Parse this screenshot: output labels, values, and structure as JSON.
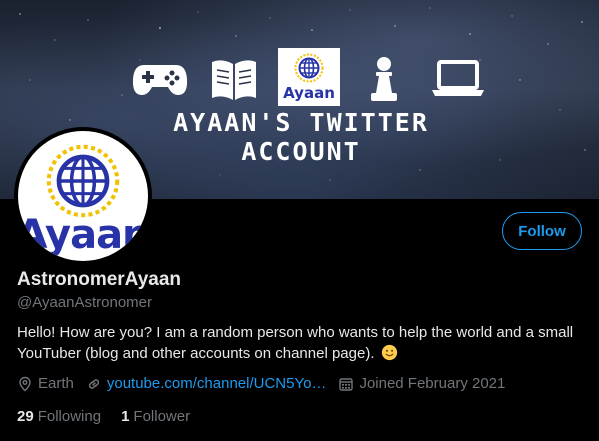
{
  "banner": {
    "title": "AYAAN'S TWITTER ACCOUNT",
    "logo_text": "Ayaan",
    "icons": [
      "gamepad-icon",
      "book-icon",
      "ayaan-logo",
      "chess-pawn-icon",
      "laptop-icon"
    ]
  },
  "avatar": {
    "text": "Ayaan"
  },
  "profile": {
    "display_name": "AstronomerAyaan",
    "handle": "@AyaanAstronomer",
    "bio": "Hello! How are you? I am a random person who wants to help the world and a small YouTuber (blog and other accounts on channel page).",
    "bio_emoji": "slightly-smiling-face"
  },
  "follow_button": {
    "label": "Follow"
  },
  "meta": {
    "location": "Earth",
    "website": "youtube.com/channel/UCN5Yo…",
    "joined": "Joined February 2021"
  },
  "counts": {
    "following_count": "29",
    "following_label": "Following",
    "followers_count": "1",
    "followers_label": "Follower"
  },
  "colors": {
    "accent": "#1d9bf0",
    "background": "#000000",
    "logo_blue": "#2733a6",
    "logo_yellow": "#f2c200",
    "muted": "#71767b"
  }
}
